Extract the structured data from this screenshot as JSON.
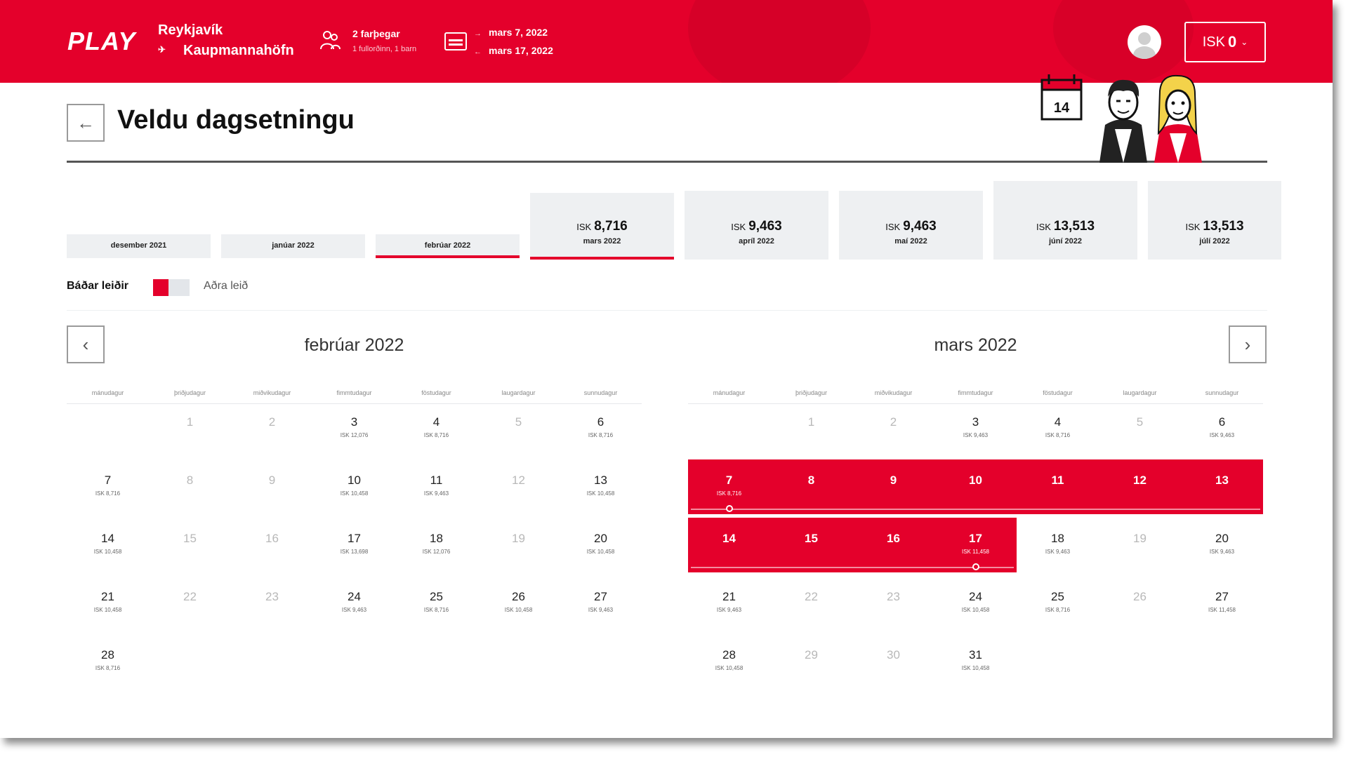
{
  "header": {
    "logo": "PLAY",
    "origin": "Reykjavík",
    "destination": "Kaupmannahöfn",
    "passengers": "2 farþegar",
    "passengers_sub": "1 fullorðinn, 1 barn",
    "date_out": "mars 7, 2022",
    "date_return": "mars 17, 2022",
    "currency": "ISK",
    "amount": "0"
  },
  "page": {
    "title": "Veldu dagsetningu",
    "illus_date": "14"
  },
  "month_tabs": [
    {
      "name": "desember 2021",
      "price": "",
      "currency": ""
    },
    {
      "name": "janúar 2022",
      "price": "",
      "currency": ""
    },
    {
      "name": "febrúar 2022",
      "price": "",
      "currency": ""
    },
    {
      "name": "mars 2022",
      "price": "8,716",
      "currency": "ISK"
    },
    {
      "name": "apríl 2022",
      "price": "9,463",
      "currency": "ISK"
    },
    {
      "name": "maí 2022",
      "price": "9,463",
      "currency": "ISK"
    },
    {
      "name": "júní 2022",
      "price": "13,513",
      "currency": "ISK"
    },
    {
      "name": "júlí 2022",
      "price": "13,513",
      "currency": "ISK"
    }
  ],
  "legend": {
    "both": "Báðar leiðir",
    "one_way": "Aðra leið"
  },
  "weekdays": [
    "mánudagur",
    "þriðjudagur",
    "miðvikudagur",
    "fimmtudagur",
    "föstudagur",
    "laugardagur",
    "sunnudagur"
  ],
  "calendars": [
    {
      "title": "febrúar 2022",
      "rows": [
        [
          null,
          {
            "d": "1",
            "p": ""
          },
          {
            "d": "2",
            "p": ""
          },
          {
            "d": "3",
            "p": "ISK 12,076"
          },
          {
            "d": "4",
            "p": "ISK 8,716"
          },
          {
            "d": "5",
            "p": ""
          },
          {
            "d": "6",
            "p": "ISK 8,716"
          }
        ],
        [
          {
            "d": "7",
            "p": "ISK 8,716"
          },
          {
            "d": "8",
            "p": ""
          },
          {
            "d": "9",
            "p": ""
          },
          {
            "d": "10",
            "p": "ISK 10,458"
          },
          {
            "d": "11",
            "p": "ISK 9,463"
          },
          {
            "d": "12",
            "p": ""
          },
          {
            "d": "13",
            "p": "ISK 10,458"
          }
        ],
        [
          {
            "d": "14",
            "p": "ISK 10,458"
          },
          {
            "d": "15",
            "p": ""
          },
          {
            "d": "16",
            "p": ""
          },
          {
            "d": "17",
            "p": "ISK 13,698"
          },
          {
            "d": "18",
            "p": "ISK 12,076"
          },
          {
            "d": "19",
            "p": ""
          },
          {
            "d": "20",
            "p": "ISK 10,458"
          }
        ],
        [
          {
            "d": "21",
            "p": "ISK 10,458"
          },
          {
            "d": "22",
            "p": ""
          },
          {
            "d": "23",
            "p": ""
          },
          {
            "d": "24",
            "p": "ISK 9,463"
          },
          {
            "d": "25",
            "p": "ISK 8,716"
          },
          {
            "d": "26",
            "p": "ISK 10,458"
          },
          {
            "d": "27",
            "p": "ISK 9,463"
          }
        ],
        [
          {
            "d": "28",
            "p": "ISK 8,716"
          },
          null,
          null,
          null,
          null,
          null,
          null
        ]
      ]
    },
    {
      "title": "mars 2022",
      "rows": [
        [
          null,
          {
            "d": "1",
            "p": ""
          },
          {
            "d": "2",
            "p": ""
          },
          {
            "d": "3",
            "p": "ISK 9,463"
          },
          {
            "d": "4",
            "p": "ISK 8,716"
          },
          {
            "d": "5",
            "p": ""
          },
          {
            "d": "6",
            "p": "ISK 9,463"
          }
        ],
        [
          {
            "d": "7",
            "p": "ISK 8,716",
            "s": 1
          },
          {
            "d": "8",
            "p": "",
            "s": 1
          },
          {
            "d": "9",
            "p": "",
            "s": 1
          },
          {
            "d": "10",
            "p": "",
            "s": 1
          },
          {
            "d": "11",
            "p": "",
            "s": 1
          },
          {
            "d": "12",
            "p": "",
            "s": 1
          },
          {
            "d": "13",
            "p": "",
            "s": 1
          }
        ],
        [
          {
            "d": "14",
            "p": "",
            "s": 1
          },
          {
            "d": "15",
            "p": "",
            "s": 1
          },
          {
            "d": "16",
            "p": "",
            "s": 1
          },
          {
            "d": "17",
            "p": "ISK 11,458",
            "s": 1
          },
          {
            "d": "18",
            "p": "ISK 9,463"
          },
          {
            "d": "19",
            "p": ""
          },
          {
            "d": "20",
            "p": "ISK 9,463"
          }
        ],
        [
          {
            "d": "21",
            "p": "ISK 9,463"
          },
          {
            "d": "22",
            "p": ""
          },
          {
            "d": "23",
            "p": ""
          },
          {
            "d": "24",
            "p": "ISK 10,458"
          },
          {
            "d": "25",
            "p": "ISK 8,716"
          },
          {
            "d": "26",
            "p": ""
          },
          {
            "d": "27",
            "p": "ISK 11,458"
          }
        ],
        [
          {
            "d": "28",
            "p": "ISK 10,458"
          },
          {
            "d": "29",
            "p": ""
          },
          {
            "d": "30",
            "p": ""
          },
          {
            "d": "31",
            "p": "ISK 10,458"
          },
          null,
          null,
          null
        ]
      ]
    }
  ],
  "colors": {
    "brand": "#e4002b",
    "tab_bg": "#eef0f2"
  }
}
